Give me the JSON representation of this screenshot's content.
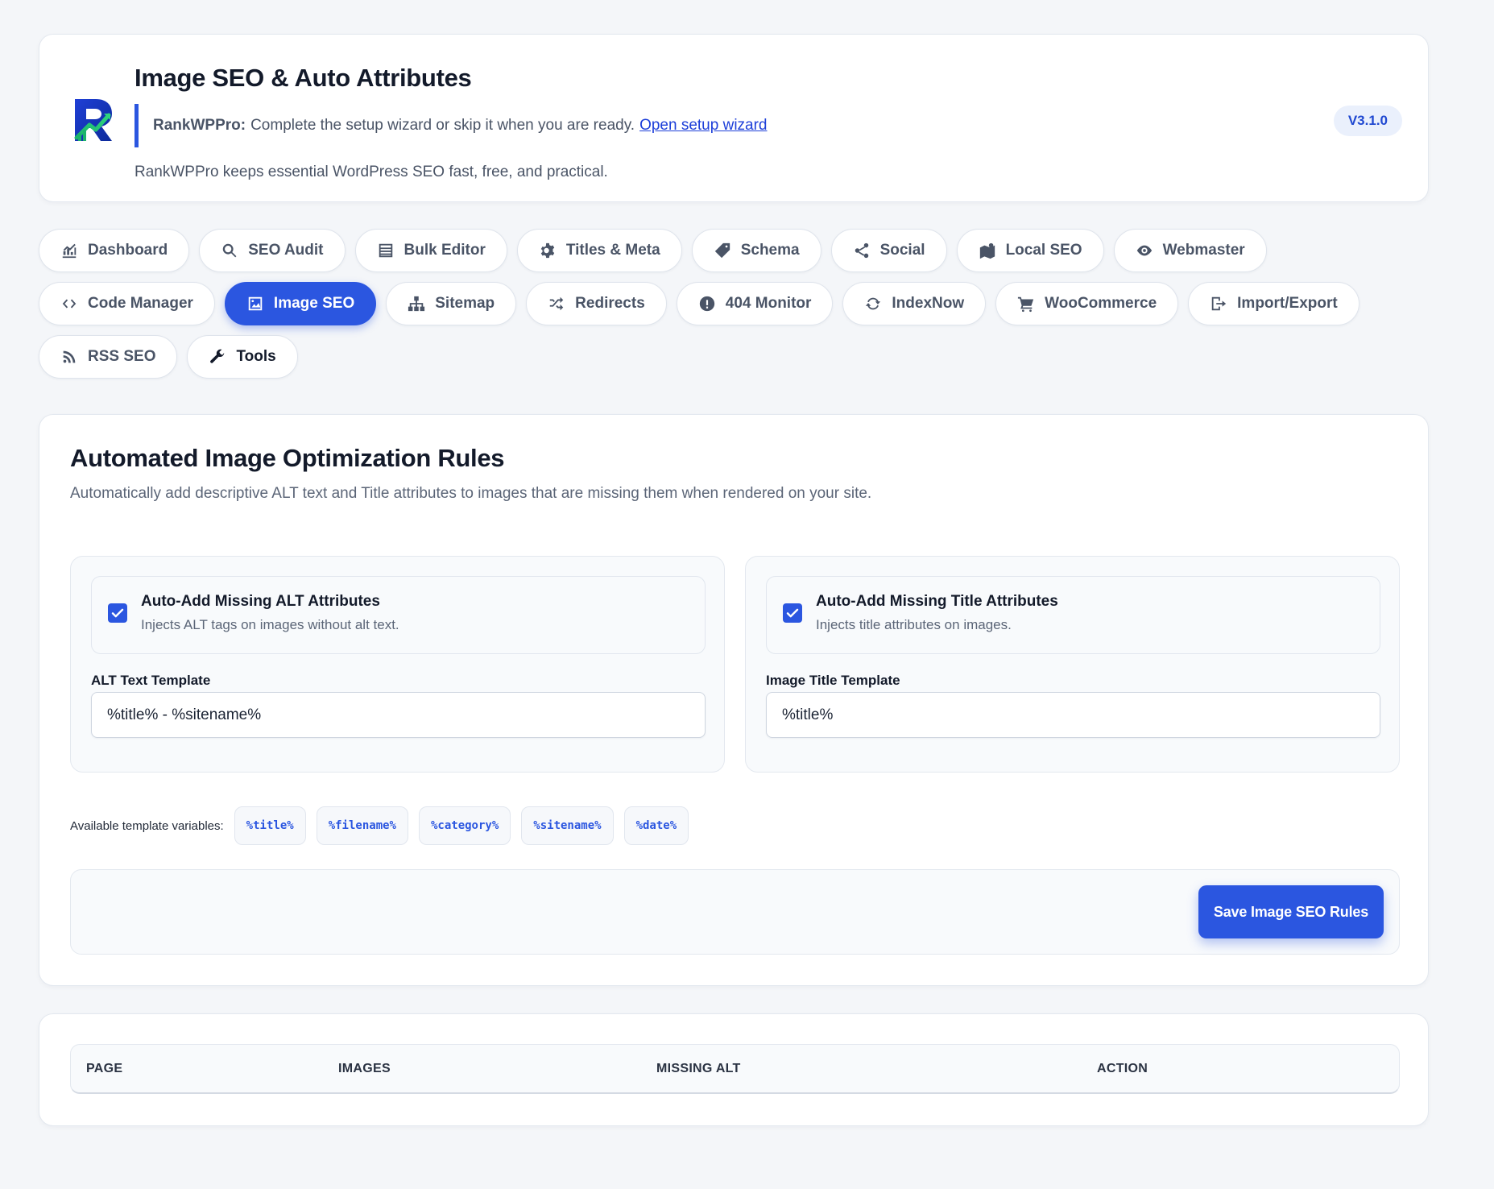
{
  "header": {
    "title": "Image SEO & Auto Attributes",
    "notice_brand": "RankWPPro:",
    "notice_text": "Complete the setup wizard or skip it when you are ready.",
    "notice_link": "Open setup wizard",
    "tagline": "RankWPPro keeps essential WordPress SEO fast, free, and practical.",
    "version": "V3.1.0"
  },
  "nav": {
    "items": [
      {
        "label": "Dashboard",
        "icon": "chart-icon"
      },
      {
        "label": "SEO Audit",
        "icon": "search-icon"
      },
      {
        "label": "Bulk Editor",
        "icon": "table-icon"
      },
      {
        "label": "Titles & Meta",
        "icon": "gear-icon"
      },
      {
        "label": "Schema",
        "icon": "tag-icon"
      },
      {
        "label": "Social",
        "icon": "share-icon"
      },
      {
        "label": "Local SEO",
        "icon": "map-icon"
      },
      {
        "label": "Webmaster",
        "icon": "eye-icon"
      },
      {
        "label": "Code Manager",
        "icon": "code-icon"
      },
      {
        "label": "Image SEO",
        "icon": "image-icon"
      },
      {
        "label": "Sitemap",
        "icon": "sitemap-icon"
      },
      {
        "label": "Redirects",
        "icon": "shuffle-icon"
      },
      {
        "label": "404 Monitor",
        "icon": "alert-icon"
      },
      {
        "label": "IndexNow",
        "icon": "sync-icon"
      },
      {
        "label": "WooCommerce",
        "icon": "cart-icon"
      },
      {
        "label": "Import/Export",
        "icon": "export-icon"
      },
      {
        "label": "RSS SEO",
        "icon": "rss-icon"
      },
      {
        "label": "Tools",
        "icon": "wrench-icon"
      }
    ],
    "active": "Image SEO"
  },
  "rules": {
    "title": "Automated Image Optimization Rules",
    "description": "Automatically add descriptive ALT text and Title attributes to images that are missing them when rendered on your site.",
    "alt": {
      "checked": true,
      "title": "Auto-Add Missing ALT Attributes",
      "subtitle": "Injects ALT tags on images without alt text.",
      "field_label": "ALT Text Template",
      "value": "%title% - %sitename%"
    },
    "title_attr": {
      "checked": true,
      "title": "Auto-Add Missing Title Attributes",
      "subtitle": "Injects title attributes on images.",
      "field_label": "Image Title Template",
      "value": "%title%"
    },
    "vars_label": "Available template variables:",
    "variables": [
      "%title%",
      "%filename%",
      "%category%",
      "%sitename%",
      "%date%"
    ],
    "save_label": "Save Image SEO Rules"
  },
  "table": {
    "columns": [
      "PAGE",
      "IMAGES",
      "MISSING ALT",
      "ACTION"
    ]
  },
  "colors": {
    "accent": "#2b56e0",
    "background": "#f4f6f9"
  }
}
